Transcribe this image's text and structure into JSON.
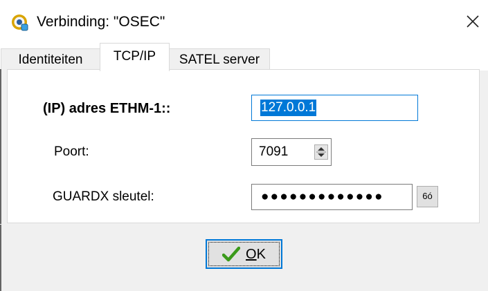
{
  "window": {
    "title": "Verbinding: \"OSEC\"",
    "close_glyph": "✕"
  },
  "tabs": [
    {
      "label": "Identiteiten",
      "active": false
    },
    {
      "label": "TCP/IP",
      "active": true
    },
    {
      "label": "SATEL server",
      "active": false
    }
  ],
  "form": {
    "ip_label": "(IP) adres ETHM-1::",
    "ip_value": "127.0.0.1",
    "port_label": "Poort:",
    "port_value": "7091",
    "key_label": "GUARDX sleutel:",
    "key_value": "●●●●●●●●●●●●●",
    "reveal_icon": "glasses-icon",
    "reveal_glyph": "6ó"
  },
  "buttons": {
    "ok_label_underlined": "O",
    "ok_label_rest": "K",
    "ok_icon": "checkmark-icon"
  },
  "colors": {
    "accent": "#0078d7",
    "check_green": "#3a9a1a"
  }
}
